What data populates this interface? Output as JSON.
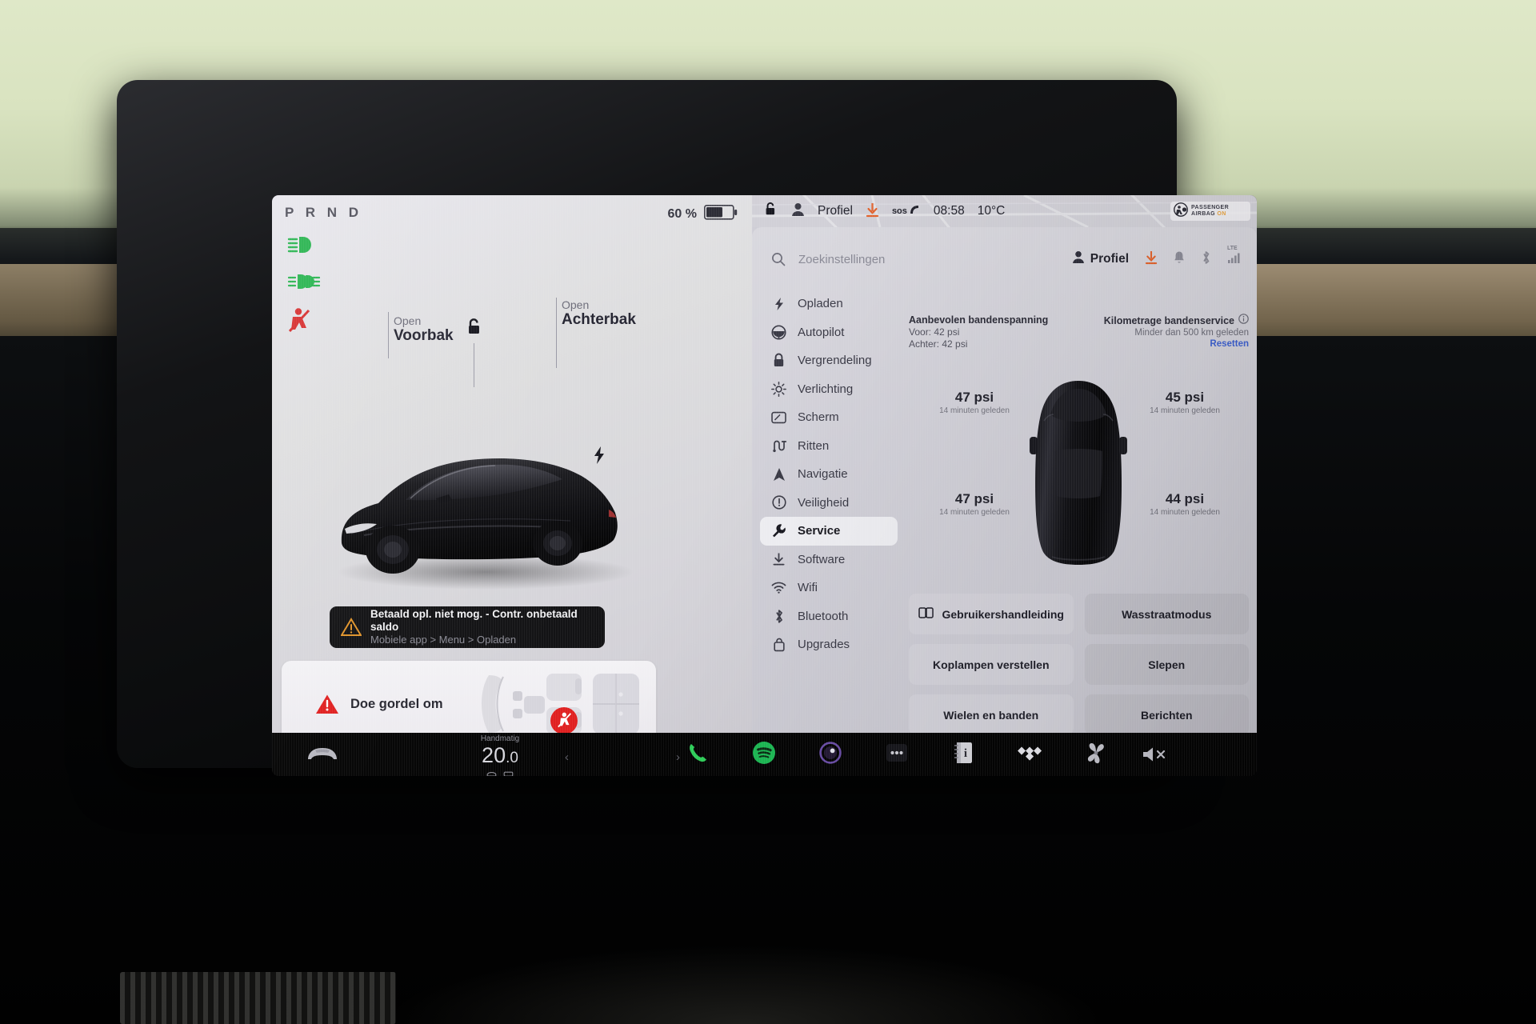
{
  "driver_panel": {
    "gear_indicator": "P R N D",
    "battery_percent": "60 %",
    "telltales": [
      {
        "name": "low-beam-headlight-icon",
        "color": "#2ab24a"
      },
      {
        "name": "front-fog-light-icon",
        "color": "#2ab24a"
      },
      {
        "name": "seatbelt-warning-icon",
        "color": "#d92b2b"
      }
    ],
    "callouts": [
      {
        "action": "Open",
        "target": "Voorbak"
      },
      {
        "action": "Open",
        "target": "Achterbak"
      }
    ],
    "unlock_icon": "unlock-icon",
    "toast": {
      "title": "Betaald opl. niet mog. - Contr. onbetaald saldo",
      "subtitle": "Mobiele app > Menu > Opladen",
      "icon": "warning-triangle-icon",
      "icon_color": "#e0932a"
    },
    "seatbelt_card": {
      "label": "Doe gordel om",
      "icon": "warning-triangle-filled-icon",
      "icon_color": "#e02020",
      "seat_badge_icon": "seatbelt-unfastened-icon"
    }
  },
  "status_bar": {
    "unlock_icon": "unlock-icon",
    "profile_icon": "person-icon",
    "profile_label": "Profiel",
    "download_icon": "software-download-icon",
    "sos_label": "sos",
    "sos_icon": "phone-handset-icon",
    "time": "08:58",
    "temperature": "10°C",
    "airbag": {
      "line1": "PASSENGER",
      "line2": "AIRBAG",
      "state": "ON"
    }
  },
  "settings": {
    "search": {
      "placeholder": "Zoekinstellingen",
      "icon": "search-icon"
    },
    "quick_icons": [
      {
        "name": "person-icon"
      },
      {
        "name": "software-download-icon",
        "color": "#e2622b"
      },
      {
        "name": "notification-bell-icon"
      },
      {
        "name": "bluetooth-icon"
      },
      {
        "name": "lte-signal-icon",
        "label": "LTE"
      }
    ],
    "profile_label": "Profiel",
    "menu": [
      {
        "label": "Opladen",
        "icon": "bolt-icon",
        "active": false
      },
      {
        "label": "Autopilot",
        "icon": "steering-wheel-icon",
        "active": false
      },
      {
        "label": "Vergrendeling",
        "icon": "lock-icon",
        "active": false
      },
      {
        "label": "Verlichting",
        "icon": "sun-brightness-icon",
        "active": false
      },
      {
        "label": "Scherm",
        "icon": "display-icon",
        "active": false
      },
      {
        "label": "Ritten",
        "icon": "trips-road-icon",
        "active": false
      },
      {
        "label": "Navigatie",
        "icon": "navigation-arrow-icon",
        "active": false
      },
      {
        "label": "Veiligheid",
        "icon": "exclamation-circle-icon",
        "active": false
      },
      {
        "label": "Service",
        "icon": "wrench-icon",
        "active": true
      },
      {
        "label": "Software",
        "icon": "download-icon",
        "active": false
      },
      {
        "label": "Wifi",
        "icon": "wifi-icon",
        "active": false
      },
      {
        "label": "Bluetooth",
        "icon": "bluetooth-icon",
        "active": false
      },
      {
        "label": "Upgrades",
        "icon": "upgrade-bag-icon",
        "active": false
      }
    ],
    "service": {
      "recommended": {
        "title": "Aanbevolen bandenspanning",
        "front": "Voor: 42 psi",
        "rear": "Achter: 42 psi"
      },
      "tire_service": {
        "title": "Kilometrage bandenservice",
        "info_icon": "info-circle-icon",
        "value": "Minder dan 500 km geleden",
        "reset_label": "Resetten",
        "reset_color": "#3b5fd0"
      },
      "tires": [
        {
          "position": "front-left",
          "pressure": "47 psi",
          "updated": "14 minuten geleden"
        },
        {
          "position": "front-right",
          "pressure": "45 psi",
          "updated": "14 minuten geleden"
        },
        {
          "position": "rear-left",
          "pressure": "47 psi",
          "updated": "14 minuten geleden"
        },
        {
          "position": "rear-right",
          "pressure": "44 psi",
          "updated": "14 minuten geleden"
        }
      ],
      "buttons": [
        {
          "label": "Gebruikershandleiding",
          "icon": "book-icon"
        },
        {
          "label": "Wasstraatmodus",
          "icon": ""
        },
        {
          "label": "Koplampen verstellen",
          "icon": ""
        },
        {
          "label": "Slepen",
          "icon": ""
        },
        {
          "label": "Wielen en banden",
          "icon": ""
        },
        {
          "label": "Berichten",
          "icon": ""
        }
      ]
    }
  },
  "dock": {
    "car_icon": "car-front-icon",
    "climate": {
      "mode": "Handmatig",
      "temp_main": "20",
      "temp_dec": ".0",
      "defrost_front_icon": "defrost-front-icon",
      "defrost_rear_icon": "defrost-rear-icon",
      "prev_icon": "chevron-left-icon",
      "next_icon": "chevron-right-icon"
    },
    "apps": [
      {
        "name": "phone-app-icon",
        "color": "#2fd05a"
      },
      {
        "name": "spotify-app-icon",
        "color": "#1db954"
      },
      {
        "name": "dashcam-app-icon",
        "color": "#6b4ea8"
      },
      {
        "name": "more-apps-icon",
        "color": "#cfcfd6"
      },
      {
        "name": "manual-app-icon",
        "color": "#d8d8de"
      },
      {
        "name": "tidal-app-icon",
        "color": "#e8e8ee"
      },
      {
        "name": "fan-climate-icon",
        "color": "#c9c9d2"
      }
    ],
    "mute_icon": "speaker-mute-icon"
  }
}
